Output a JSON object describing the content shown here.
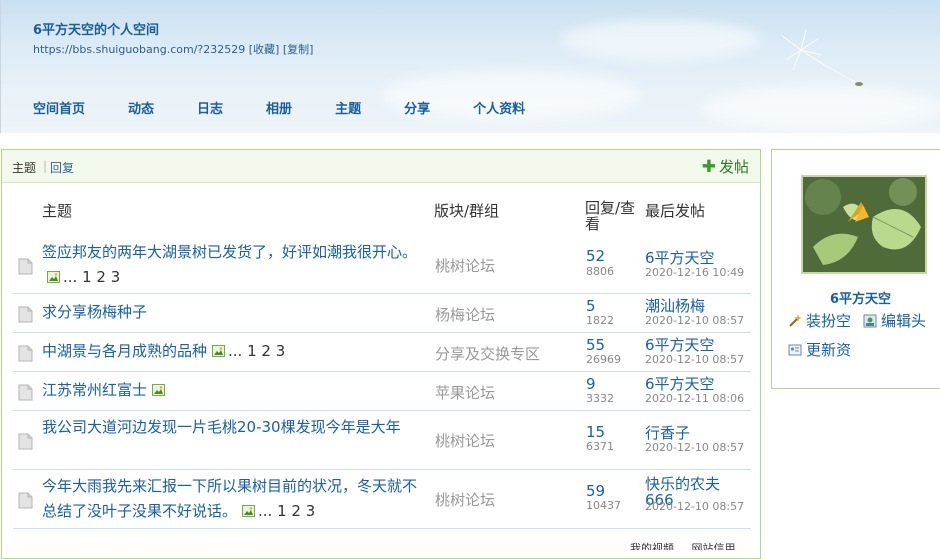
{
  "header": {
    "title": "6平方天空的个人空间",
    "url": "https://bbs.shuiguobang.com/?232529",
    "favorite": "[收藏]",
    "copy": "[复制]",
    "nav": [
      "空间首页",
      "动态",
      "日志",
      "相册",
      "主题",
      "分享",
      "个人资料"
    ]
  },
  "tabs": {
    "active": "主题",
    "sep": "|",
    "other": "回复"
  },
  "post_button": "发帖",
  "columns": {
    "topic": "主题",
    "forum": "版块/群组",
    "reply_view": "回复/查看",
    "last_post": "最后发帖"
  },
  "threads": [
    {
      "title": "签应邦友的两年大湖景树已发货了，好评如潮我很开心。",
      "has_image": true,
      "pages": "... 1 2 3",
      "forum": "桃树论坛",
      "replies": "52",
      "views": "8806",
      "last_author": "6平方天空",
      "last_date": "2020-12-16 10:49"
    },
    {
      "title": "求分享杨梅种子",
      "has_image": false,
      "pages": "",
      "forum": "杨梅论坛",
      "replies": "5",
      "views": "1822",
      "last_author": "潮汕杨梅",
      "last_date": "2020-12-10 08:57"
    },
    {
      "title": "中湖景与各月成熟的品种",
      "has_image": true,
      "pages": "... 1 2 3",
      "forum": "分享及交换专区",
      "replies": "55",
      "views": "26969",
      "last_author": "6平方天空",
      "last_date": "2020-12-10 08:57"
    },
    {
      "title": "江苏常州红富士",
      "has_image": true,
      "pages": "",
      "forum": "苹果论坛",
      "replies": "9",
      "views": "3332",
      "last_author": "6平方天空",
      "last_date": "2020-12-11 08:06"
    },
    {
      "title": "我公司大道河边发现一片毛桃20-30棵发现今年是大年",
      "has_image": false,
      "pages": "",
      "forum": "桃树论坛",
      "replies": "15",
      "views": "6371",
      "last_author": "行香子",
      "last_date": "2020-12-10 08:57"
    },
    {
      "title": "今年大雨我先来汇报一下所以果树目前的状况，冬天就不总结了没叶子没果不好说话。",
      "has_image": true,
      "pages": "... 1 2 3",
      "forum": "桃树论坛",
      "replies": "59",
      "views": "10437",
      "last_author": "快乐的农夫666",
      "last_date": "2020-12-10 08:57"
    }
  ],
  "sidebar": {
    "name": "6平方天空",
    "links": [
      "装扮空",
      "编辑头",
      "更新资"
    ]
  },
  "taskbar": [
    "我的视频",
    "网站信用"
  ]
}
